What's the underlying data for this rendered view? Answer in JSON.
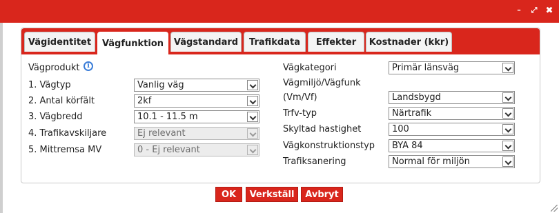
{
  "window": {
    "controls": {
      "minimize": "–",
      "maximize": "⤢",
      "close": "✖"
    }
  },
  "tabs": [
    {
      "label": "Vägidentitet"
    },
    {
      "label": "Vägfunktion"
    },
    {
      "label": "Vägstandard"
    },
    {
      "label": "Trafikdata"
    },
    {
      "label": "Effekter"
    },
    {
      "label": "Kostnader (kkr)"
    }
  ],
  "active_tab": "Vägfunktion",
  "left": {
    "heading": "Vägprodukt",
    "info_glyph": "i",
    "fields": [
      {
        "label": "1. Vägtyp",
        "value": "Vanlig väg",
        "disabled": false
      },
      {
        "label": "2. Antal körfält",
        "value": "2kf",
        "disabled": false
      },
      {
        "label": "3. Vägbredd",
        "value": "10.1 - 11.5 m",
        "disabled": false
      },
      {
        "label": "4. Trafikavskiljare",
        "value": "Ej relevant",
        "disabled": true
      },
      {
        "label": "5. Mittremsa MV",
        "value": "0 - Ej relevant",
        "disabled": true
      }
    ]
  },
  "right": {
    "vagmiljo_line1": "Vägmiljö/Vägfunk",
    "vagmiljo_line2": "(Vm/Vf)",
    "fields": [
      {
        "label": "Vägkategori",
        "value": "Primär länsväg"
      },
      {
        "label": "",
        "value": "Landsbygd"
      },
      {
        "label": "Trfv-typ",
        "value": "Närtrafik"
      },
      {
        "label": "Skyltad hastighet",
        "value": "100"
      },
      {
        "label": "Vägkonstruktionstyp",
        "value": "BYA 84"
      },
      {
        "label": "Trafiksanering",
        "value": "Normal för miljön"
      }
    ]
  },
  "buttons": {
    "ok": "OK",
    "apply": "Verkställ",
    "cancel": "Avbryt"
  },
  "colors": {
    "accent": "#d9261c",
    "info": "#3b7dd8"
  }
}
